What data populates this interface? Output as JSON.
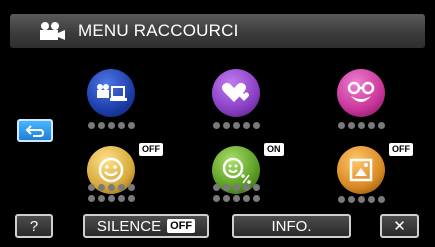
{
  "header": {
    "title": "MENU RACCOURCI",
    "icon": "movie-camera-icon"
  },
  "items": [
    {
      "icon": "film-to-computer-icon",
      "color": "#1c3ea8",
      "flag": ""
    },
    {
      "icon": "hearts-icon",
      "color": "#8a3fc4",
      "flag": ""
    },
    {
      "icon": "face-with-glasses-icon",
      "color": "#c8359a",
      "flag": ""
    },
    {
      "icon": "smile-shutter-icon",
      "color": "#d6a93a",
      "flag": "OFF"
    },
    {
      "icon": "smile-percent-icon",
      "color": "#5b9c23",
      "flag": "ON"
    },
    {
      "icon": "auto-scene-icon",
      "color": "#d98a24",
      "flag": "OFF"
    }
  ],
  "bottom": {
    "help": "?",
    "silence": "SILENCE",
    "silence_state": "OFF",
    "info": "INFO.",
    "close": "✕"
  },
  "colors": {
    "back_button": "#2f9bf0",
    "header_bg": "#4a4a4a",
    "dots": "#7a7a7a"
  }
}
